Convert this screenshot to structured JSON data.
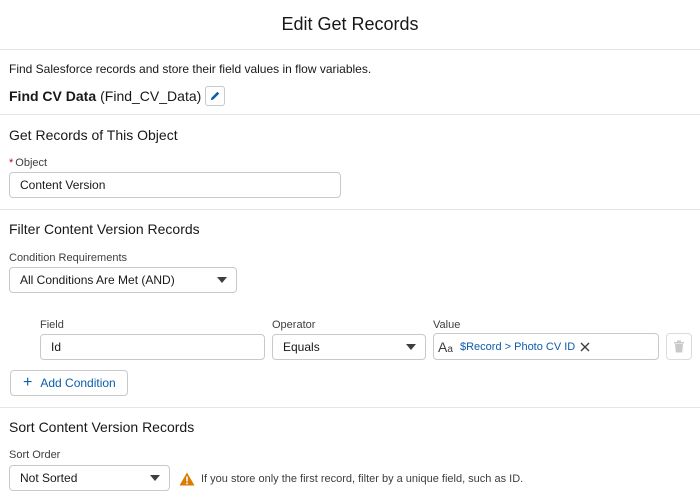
{
  "header": {
    "title": "Edit Get Records"
  },
  "description": "Find Salesforce records and store their field values in flow variables.",
  "element": {
    "label": "Find CV Data",
    "api_name": "(Find_CV_Data)"
  },
  "object_section": {
    "title": "Get Records of This Object",
    "object_label": "Object",
    "required_marker": "*",
    "object_value": "Content Version"
  },
  "filter_section": {
    "title": "Filter Content Version Records",
    "condition_label": "Condition Requirements",
    "condition_value": "All Conditions Are Met (AND)",
    "columns": {
      "field": "Field",
      "operator": "Operator",
      "value": "Value"
    },
    "row": {
      "field": "Id",
      "operator": "Equals",
      "value_pill": "$Record > Photo CV ID"
    },
    "add_condition_label": "Add Condition"
  },
  "sort_section": {
    "title": "Sort Content Version Records",
    "sort_label": "Sort Order",
    "sort_value": "Not Sorted",
    "warning": "If you store only the first record, filter by a unique field, such as ID."
  },
  "colors": {
    "brand": "#0b5cab",
    "warning": "#dd7a01",
    "required": "#ba0517"
  },
  "icons": [
    "pencil-icon",
    "text-type-icon",
    "close-icon",
    "trash-icon",
    "plus-icon",
    "warning-icon",
    "chevron-down-icon"
  ]
}
